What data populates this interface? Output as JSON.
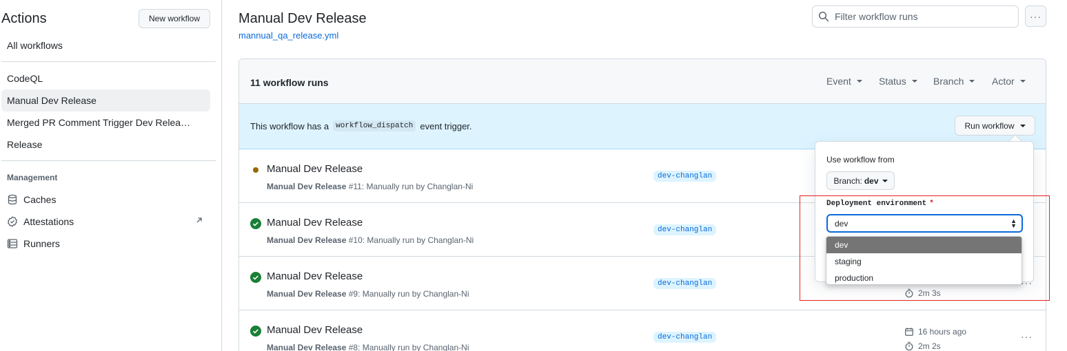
{
  "sidebar": {
    "title": "Actions",
    "new_workflow_label": "New workflow",
    "all_workflows": "All workflows",
    "workflows": [
      {
        "label": "CodeQL",
        "active": false
      },
      {
        "label": "Manual Dev Release",
        "active": true
      },
      {
        "label": "Merged PR Comment Trigger Dev Relea…",
        "active": false
      },
      {
        "label": "Release",
        "active": false
      }
    ],
    "management_heading": "Management",
    "management": [
      {
        "label": "Caches",
        "icon": "database-icon"
      },
      {
        "label": "Attestations",
        "icon": "verified-icon"
      },
      {
        "label": "Runners",
        "icon": "server-icon"
      }
    ]
  },
  "header": {
    "title": "Manual Dev Release",
    "workflow_file": "mannual_qa_release.yml",
    "filter_placeholder": "Filter workflow runs",
    "more_label": "···"
  },
  "runs_box": {
    "count_label": "11 workflow runs",
    "filters": [
      "Event",
      "Status",
      "Branch",
      "Actor"
    ],
    "dispatch_prefix": "This workflow has a",
    "dispatch_code": "workflow_dispatch",
    "dispatch_suffix": "event trigger.",
    "run_workflow_label": "Run workflow"
  },
  "runs": [
    {
      "status": "in-progress",
      "title": "Manual Dev Release",
      "meta_name": "Manual Dev Release",
      "meta_rest": " #11: Manually run by Changlan-Ni",
      "branch": "dev-changlan",
      "date": "",
      "duration": ""
    },
    {
      "status": "success",
      "title": "Manual Dev Release",
      "meta_name": "Manual Dev Release",
      "meta_rest": " #10: Manually run by Changlan-Ni",
      "branch": "dev-changlan",
      "date": "",
      "duration": ""
    },
    {
      "status": "success",
      "title": "Manual Dev Release",
      "meta_name": "Manual Dev Release",
      "meta_rest": " #9: Manually run by Changlan-Ni",
      "branch": "dev-changlan",
      "date": "",
      "duration": "2m 3s"
    },
    {
      "status": "success",
      "title": "Manual Dev Release",
      "meta_name": "Manual Dev Release",
      "meta_rest": " #8: Manually run by Changlan-Ni",
      "branch": "dev-changlan",
      "date": "16 hours ago",
      "duration": "2m 2s"
    }
  ],
  "popover": {
    "use_workflow_from": "Use workflow from",
    "branch_prefix": "Branch:",
    "branch_value": "dev",
    "deploy_label": "Deployment environment",
    "required_mark": "*",
    "selected_env": "dev",
    "env_options": [
      "dev",
      "staging",
      "production"
    ],
    "highlighted_option": "dev"
  },
  "colors": {
    "accent": "#0969da",
    "success": "#1a7f37",
    "in_progress": "#9a6700",
    "highlight": "#e5221b",
    "dispatch_bg": "#ddf4ff"
  }
}
